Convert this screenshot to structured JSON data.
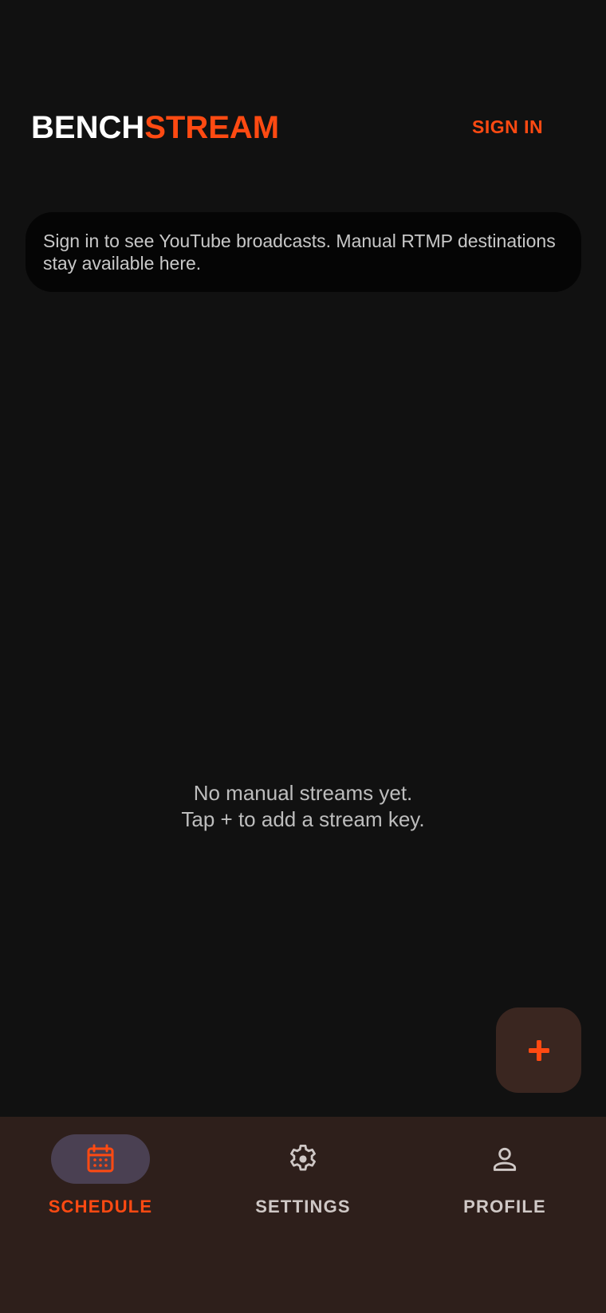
{
  "header": {
    "logo_part1": "BENCH",
    "logo_part2": "STREAM",
    "signin_label": "SIGN IN"
  },
  "banner": {
    "text": "Sign in to see YouTube broadcasts. Manual RTMP destinations stay available here."
  },
  "empty_state": {
    "line1": "No manual streams yet.",
    "line2": "Tap + to add a stream key."
  },
  "fab": {
    "icon": "plus-icon"
  },
  "nav": {
    "items": [
      {
        "label": "SCHEDULE",
        "icon": "calendar-icon",
        "active": true
      },
      {
        "label": "SETTINGS",
        "icon": "gear-icon",
        "active": false
      },
      {
        "label": "PROFILE",
        "icon": "person-icon",
        "active": false
      }
    ]
  },
  "colors": {
    "accent": "#ff4a12",
    "background": "#111111",
    "navbar": "#2e1f1b",
    "active_pill": "#4a4052"
  }
}
